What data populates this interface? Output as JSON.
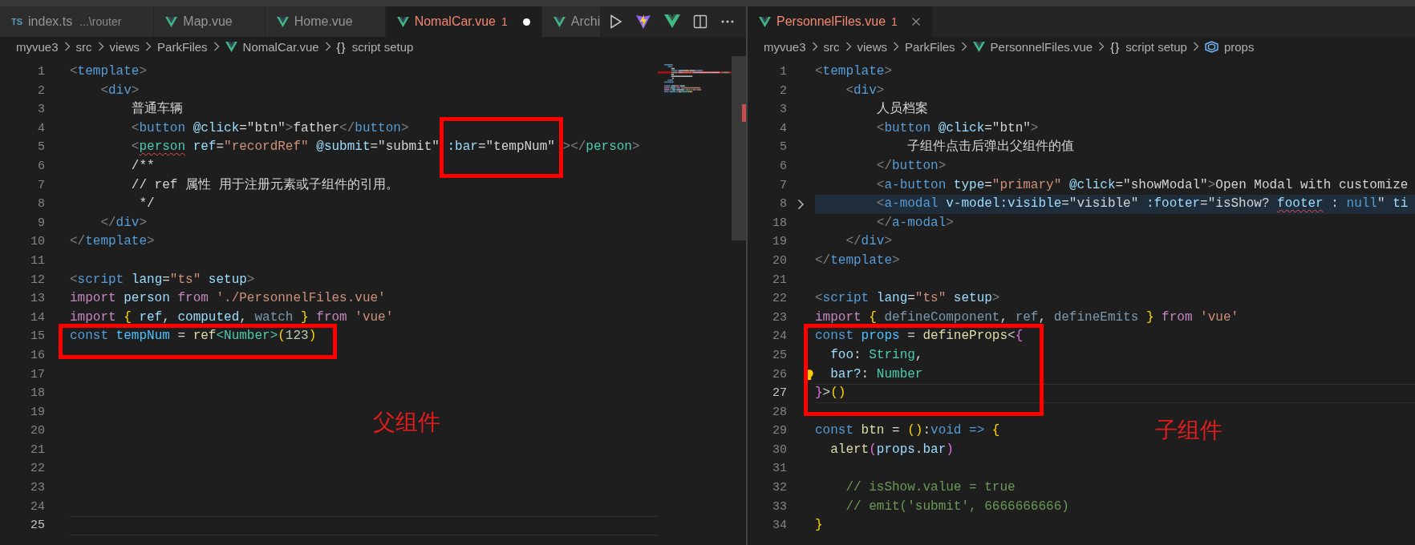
{
  "panes": [
    {
      "tabs": [
        {
          "label": "index.ts",
          "description": "...\\router",
          "kind": "ts",
          "icon_text": "TS",
          "selected": false
        },
        {
          "label": "Map.vue",
          "kind": "vue",
          "selected": false
        },
        {
          "label": "Home.vue",
          "kind": "vue",
          "selected": false
        },
        {
          "label": "NomalCar.vue",
          "problems": "1",
          "kind": "vue",
          "selected": true,
          "dirty": true
        },
        {
          "label": "Archi",
          "kind": "vue",
          "selected": false
        }
      ],
      "actions": [
        {
          "kind": "run"
        },
        {
          "kind": "vite"
        },
        {
          "kind": "devtools"
        },
        {
          "kind": "split"
        },
        {
          "kind": "more"
        }
      ],
      "breadcrumbs": [
        {
          "label": "myvue3",
          "kind": "folder"
        },
        {
          "label": "src",
          "kind": "folder"
        },
        {
          "label": "views",
          "kind": "folder"
        },
        {
          "label": "ParkFiles",
          "kind": "folder"
        },
        {
          "label": "NomalCar.vue",
          "kind": "vue"
        },
        {
          "label": "script setup",
          "kind": "braces",
          "icon_text": "{}"
        }
      ],
      "lines": [
        {
          "n": "1",
          "current": false,
          "boxed": false,
          "tokens": [
            {
              "kind": "p",
              "text": "<"
            },
            {
              "kind": "tag",
              "text": "template"
            },
            {
              "kind": "p",
              "text": ">"
            }
          ]
        },
        {
          "n": "2",
          "current": false,
          "boxed": false,
          "tokens": [
            {
              "kind": "p",
              "text": "    <"
            },
            {
              "kind": "tag",
              "text": "div"
            },
            {
              "kind": "p",
              "text": ">"
            }
          ]
        },
        {
          "n": "3",
          "current": false,
          "boxed": false,
          "tokens": [
            {
              "kind": "x",
              "text": "        普通车辆"
            }
          ]
        },
        {
          "n": "4",
          "current": false,
          "boxed": false,
          "tokens": [
            {
              "kind": "p",
              "text": "        <"
            },
            {
              "kind": "tag",
              "text": "button"
            },
            {
              "kind": "attr",
              "text": " @click"
            },
            {
              "kind": "x",
              "text": "=\"btn\""
            },
            {
              "kind": "p",
              "text": ">"
            },
            {
              "kind": "x",
              "text": "father"
            },
            {
              "kind": "p",
              "text": "</"
            },
            {
              "kind": "tag",
              "text": "button"
            },
            {
              "kind": "p",
              "text": ">"
            }
          ]
        },
        {
          "n": "5",
          "current": false,
          "boxed": false,
          "tokens": [
            {
              "kind": "p",
              "text": "        <"
            },
            {
              "kind": "comp",
              "text": "person",
              "squiggle": true
            },
            {
              "kind": "attr",
              "text": " ref"
            },
            {
              "kind": "x",
              "text": "="
            },
            {
              "kind": "str",
              "text": "\"recordRef\""
            },
            {
              "kind": "attr",
              "text": " @submit"
            },
            {
              "kind": "x",
              "text": "=\"submit\" "
            },
            {
              "kind": "group",
              "boxed": true,
              "tokens": [
                {
                  "kind": "attr",
                  "text": ":bar"
                },
                {
                  "kind": "x",
                  "text": "=\"tempNum\""
                }
              ]
            },
            {
              "kind": "p",
              "text": " ></"
            },
            {
              "kind": "comp",
              "text": "person"
            },
            {
              "kind": "p",
              "text": ">"
            }
          ]
        },
        {
          "n": "6",
          "current": false,
          "boxed": false,
          "tokens": [
            {
              "kind": "x",
              "text": "        /**"
            }
          ]
        },
        {
          "n": "7",
          "current": false,
          "boxed": false,
          "tokens": [
            {
              "kind": "x",
              "text": "        // ref 属性 用于注册元素或子组件的引用。"
            }
          ]
        },
        {
          "n": "8",
          "current": false,
          "boxed": false,
          "tokens": [
            {
              "kind": "x",
              "text": "         */"
            }
          ]
        },
        {
          "n": "9",
          "current": false,
          "boxed": false,
          "tokens": [
            {
              "kind": "p",
              "text": "    </"
            },
            {
              "kind": "tag",
              "text": "div"
            },
            {
              "kind": "p",
              "text": ">"
            }
          ]
        },
        {
          "n": "10",
          "current": false,
          "boxed": false,
          "tokens": [
            {
              "kind": "p",
              "text": "</"
            },
            {
              "kind": "tag",
              "text": "template"
            },
            {
              "kind": "p",
              "text": ">"
            }
          ]
        },
        {
          "n": "11",
          "current": false,
          "boxed": false
        },
        {
          "n": "12",
          "current": false,
          "boxed": false,
          "tokens": [
            {
              "kind": "p",
              "text": "<"
            },
            {
              "kind": "tag",
              "text": "script"
            },
            {
              "kind": "attr",
              "text": " lang"
            },
            {
              "kind": "x",
              "text": "="
            },
            {
              "kind": "str",
              "text": "\"ts\""
            },
            {
              "kind": "attr",
              "text": " setup"
            },
            {
              "kind": "p",
              "text": ">"
            }
          ]
        },
        {
          "n": "13",
          "current": false,
          "boxed": false,
          "tokens": [
            {
              "kind": "kw",
              "text": "import"
            },
            {
              "kind": "var",
              "text": " person"
            },
            {
              "kind": "kw",
              "text": " from"
            },
            {
              "kind": "str",
              "text": " './PersonnelFiles.vue'"
            }
          ]
        },
        {
          "n": "14",
          "current": false,
          "boxed": false,
          "tokens": [
            {
              "kind": "kw",
              "text": "import"
            },
            {
              "kind": "b1",
              "text": " {"
            },
            {
              "kind": "var",
              "text": " ref"
            },
            {
              "kind": "x",
              "text": ","
            },
            {
              "kind": "var",
              "text": " computed"
            },
            {
              "kind": "x",
              "text": ","
            },
            {
              "kind": "dim",
              "text": " watch"
            },
            {
              "kind": "b1",
              "text": " }"
            },
            {
              "kind": "kw",
              "text": " from"
            },
            {
              "kind": "str",
              "text": " 'vue'"
            }
          ]
        },
        {
          "n": "15",
          "current": false,
          "boxed": true,
          "tokens": [
            {
              "kind": "st",
              "text": "const"
            },
            {
              "kind": "const",
              "text": " tempNum"
            },
            {
              "kind": "x",
              "text": " ="
            },
            {
              "kind": "fn",
              "text": " ref"
            },
            {
              "kind": "type",
              "text": "<Number>"
            },
            {
              "kind": "b1",
              "text": "("
            },
            {
              "kind": "num",
              "text": "123"
            },
            {
              "kind": "b1",
              "text": ")"
            }
          ]
        },
        {
          "n": "16",
          "current": false,
          "boxed": false
        },
        {
          "n": "17",
          "current": false,
          "boxed": false
        },
        {
          "n": "18",
          "current": false,
          "boxed": false
        },
        {
          "n": "19",
          "current": false,
          "boxed": false
        },
        {
          "n": "20",
          "current": false,
          "boxed": false
        },
        {
          "n": "21",
          "current": false,
          "boxed": false
        },
        {
          "n": "22",
          "current": false,
          "boxed": false
        },
        {
          "n": "23",
          "current": false,
          "boxed": false
        },
        {
          "n": "24",
          "current": false,
          "boxed": false
        },
        {
          "n": "25",
          "current": true,
          "boxed": false
        }
      ],
      "annotation": {
        "label": "父组件"
      }
    },
    {
      "tabs": [
        {
          "label": "PersonnelFiles.vue",
          "problems": "1",
          "kind": "vue",
          "selected": true,
          "dirty": false
        }
      ],
      "breadcrumbs": [
        {
          "label": "myvue3",
          "kind": "folder"
        },
        {
          "label": "src",
          "kind": "folder"
        },
        {
          "label": "views",
          "kind": "folder"
        },
        {
          "label": "ParkFiles",
          "kind": "folder"
        },
        {
          "label": "PersonnelFiles.vue",
          "kind": "vue"
        },
        {
          "label": "script setup",
          "kind": "braces",
          "icon_text": "{}"
        },
        {
          "label": "props",
          "kind": "field"
        }
      ],
      "lines": [
        {
          "n": "1",
          "current": false,
          "boxed": false,
          "folded": false,
          "tokens": [
            {
              "kind": "p",
              "text": "<"
            },
            {
              "kind": "tag",
              "text": "template"
            },
            {
              "kind": "p",
              "text": ">"
            }
          ]
        },
        {
          "n": "2",
          "current": false,
          "boxed": false,
          "folded": false,
          "tokens": [
            {
              "kind": "p",
              "text": "    <"
            },
            {
              "kind": "tag",
              "text": "div"
            },
            {
              "kind": "p",
              "text": ">"
            }
          ]
        },
        {
          "n": "3",
          "current": false,
          "boxed": false,
          "folded": false,
          "tokens": [
            {
              "kind": "x",
              "text": "        人员档案"
            }
          ]
        },
        {
          "n": "4",
          "current": false,
          "boxed": false,
          "folded": false,
          "tokens": [
            {
              "kind": "p",
              "text": "        <"
            },
            {
              "kind": "tag",
              "text": "button"
            },
            {
              "kind": "attr",
              "text": " @click"
            },
            {
              "kind": "x",
              "text": "=\"btn\""
            },
            {
              "kind": "p",
              "text": ">"
            }
          ]
        },
        {
          "n": "5",
          "current": false,
          "boxed": false,
          "folded": false,
          "tokens": [
            {
              "kind": "x",
              "text": "            子组件点击后弹出父组件的值"
            }
          ]
        },
        {
          "n": "6",
          "current": false,
          "boxed": false,
          "folded": false,
          "tokens": [
            {
              "kind": "p",
              "text": "        </"
            },
            {
              "kind": "tag",
              "text": "button"
            },
            {
              "kind": "p",
              "text": ">"
            }
          ]
        },
        {
          "n": "7",
          "current": false,
          "boxed": false,
          "folded": false,
          "tokens": [
            {
              "kind": "p",
              "text": "        <"
            },
            {
              "kind": "tag",
              "text": "a-button"
            },
            {
              "kind": "attr",
              "text": " type"
            },
            {
              "kind": "x",
              "text": "="
            },
            {
              "kind": "str",
              "text": "\"primary\""
            },
            {
              "kind": "attr",
              "text": " @click"
            },
            {
              "kind": "x",
              "text": "=\"showModal\""
            },
            {
              "kind": "p",
              "text": ">"
            },
            {
              "kind": "x",
              "text": "Open Modal with customize"
            }
          ]
        },
        {
          "n": "8",
          "current": false,
          "boxed": false,
          "folded": true,
          "tokens": [
            {
              "kind": "p",
              "text": "        <"
            },
            {
              "kind": "tag",
              "text": "a-modal"
            },
            {
              "kind": "attr",
              "text": " v-model:visible"
            },
            {
              "kind": "x",
              "text": "=\"visible\""
            },
            {
              "kind": "attr",
              "text": " :footer"
            },
            {
              "kind": "x",
              "text": "=\"isShow? "
            },
            {
              "kind": "var",
              "text": "footer",
              "squiggle": true
            },
            {
              "kind": "x",
              "text": " :"
            },
            {
              "kind": "st",
              "text": " null"
            },
            {
              "kind": "x",
              "text": "\""
            },
            {
              "kind": "attr",
              "text": " ti"
            }
          ]
        },
        {
          "n": "18",
          "current": false,
          "boxed": false,
          "folded": false,
          "tokens": [
            {
              "kind": "p",
              "text": "        </"
            },
            {
              "kind": "tag",
              "text": "a-modal"
            },
            {
              "kind": "p",
              "text": ">"
            }
          ]
        },
        {
          "n": "19",
          "current": false,
          "boxed": false,
          "folded": false,
          "tokens": [
            {
              "kind": "p",
              "text": "    </"
            },
            {
              "kind": "tag",
              "text": "div"
            },
            {
              "kind": "p",
              "text": ">"
            }
          ]
        },
        {
          "n": "20",
          "current": false,
          "boxed": false,
          "folded": false,
          "tokens": [
            {
              "kind": "p",
              "text": "</"
            },
            {
              "kind": "tag",
              "text": "template"
            },
            {
              "kind": "p",
              "text": ">"
            }
          ]
        },
        {
          "n": "21",
          "current": false,
          "boxed": false,
          "folded": false
        },
        {
          "n": "22",
          "current": false,
          "boxed": false,
          "folded": false,
          "tokens": [
            {
              "kind": "p",
              "text": "<"
            },
            {
              "kind": "tag",
              "text": "script"
            },
            {
              "kind": "attr",
              "text": " lang"
            },
            {
              "kind": "x",
              "text": "="
            },
            {
              "kind": "str",
              "text": "\"ts\""
            },
            {
              "kind": "attr",
              "text": " setup"
            },
            {
              "kind": "p",
              "text": ">"
            }
          ]
        },
        {
          "n": "23",
          "current": false,
          "boxed": false,
          "folded": false,
          "tokens": [
            {
              "kind": "kw",
              "text": "import"
            },
            {
              "kind": "b1",
              "text": " {"
            },
            {
              "kind": "dim",
              "text": " defineComponent"
            },
            {
              "kind": "x",
              "text": ","
            },
            {
              "kind": "dim",
              "text": " ref"
            },
            {
              "kind": "x",
              "text": ","
            },
            {
              "kind": "dim",
              "text": " defineEmits"
            },
            {
              "kind": "b1",
              "text": " }"
            },
            {
              "kind": "kw",
              "text": " from"
            },
            {
              "kind": "str",
              "text": " 'vue'"
            }
          ]
        },
        {
          "n": "24",
          "current": false,
          "boxed": true,
          "folded": false,
          "tokens": [
            {
              "kind": "st",
              "text": "const"
            },
            {
              "kind": "const",
              "text": " props"
            },
            {
              "kind": "x",
              "text": " ="
            },
            {
              "kind": "fn",
              "text": " defineProps"
            },
            {
              "kind": "x",
              "text": "<"
            },
            {
              "kind": "b2",
              "text": "{"
            }
          ]
        },
        {
          "n": "25",
          "current": false,
          "boxed": true,
          "folded": false,
          "tokens": [
            {
              "kind": "var",
              "text": "  foo"
            },
            {
              "kind": "x",
              "text": ":"
            },
            {
              "kind": "type",
              "text": " String"
            },
            {
              "kind": "x",
              "text": ","
            }
          ]
        },
        {
          "n": "26",
          "current": false,
          "boxed": true,
          "folded": false,
          "lightbulb": true,
          "tokens": [
            {
              "kind": "var",
              "text": "  bar?"
            },
            {
              "kind": "x",
              "text": ":"
            },
            {
              "kind": "type",
              "text": " Number"
            }
          ]
        },
        {
          "n": "27",
          "current": true,
          "boxed": true,
          "folded": false,
          "tokens": [
            {
              "kind": "b2",
              "text": "}"
            },
            {
              "kind": "x",
              "text": ">"
            },
            {
              "kind": "b1",
              "text": "()"
            }
          ]
        },
        {
          "n": "28",
          "current": false,
          "boxed": false,
          "folded": false
        },
        {
          "n": "29",
          "current": false,
          "boxed": false,
          "folded": false,
          "tokens": [
            {
              "kind": "st",
              "text": "const"
            },
            {
              "kind": "fn",
              "text": " btn"
            },
            {
              "kind": "x",
              "text": " ="
            },
            {
              "kind": "b1",
              "text": " ()"
            },
            {
              "kind": "x",
              "text": ":"
            },
            {
              "kind": "st",
              "text": "void"
            },
            {
              "kind": "st",
              "text": " =>"
            },
            {
              "kind": "b1",
              "text": " {"
            }
          ]
        },
        {
          "n": "30",
          "current": false,
          "boxed": false,
          "folded": false,
          "tokens": [
            {
              "kind": "fn",
              "text": "  alert"
            },
            {
              "kind": "b2",
              "text": "("
            },
            {
              "kind": "var",
              "text": "props"
            },
            {
              "kind": "x",
              "text": "."
            },
            {
              "kind": "var",
              "text": "bar"
            },
            {
              "kind": "b2",
              "text": ")"
            }
          ]
        },
        {
          "n": "31",
          "current": false,
          "boxed": false,
          "folded": false
        },
        {
          "n": "32",
          "current": false,
          "boxed": false,
          "folded": false,
          "tokens": [
            {
              "kind": "cm",
              "text": "    // isShow.value = true"
            }
          ]
        },
        {
          "n": "33",
          "current": false,
          "boxed": false,
          "folded": false,
          "tokens": [
            {
              "kind": "cm",
              "text": "    // emit('submit', 6666666666)"
            }
          ]
        },
        {
          "n": "34",
          "current": false,
          "boxed": false,
          "folded": false,
          "tokens": [
            {
              "kind": "b1",
              "text": "}"
            }
          ]
        }
      ],
      "annotation": {
        "label": "子组件"
      }
    }
  ]
}
